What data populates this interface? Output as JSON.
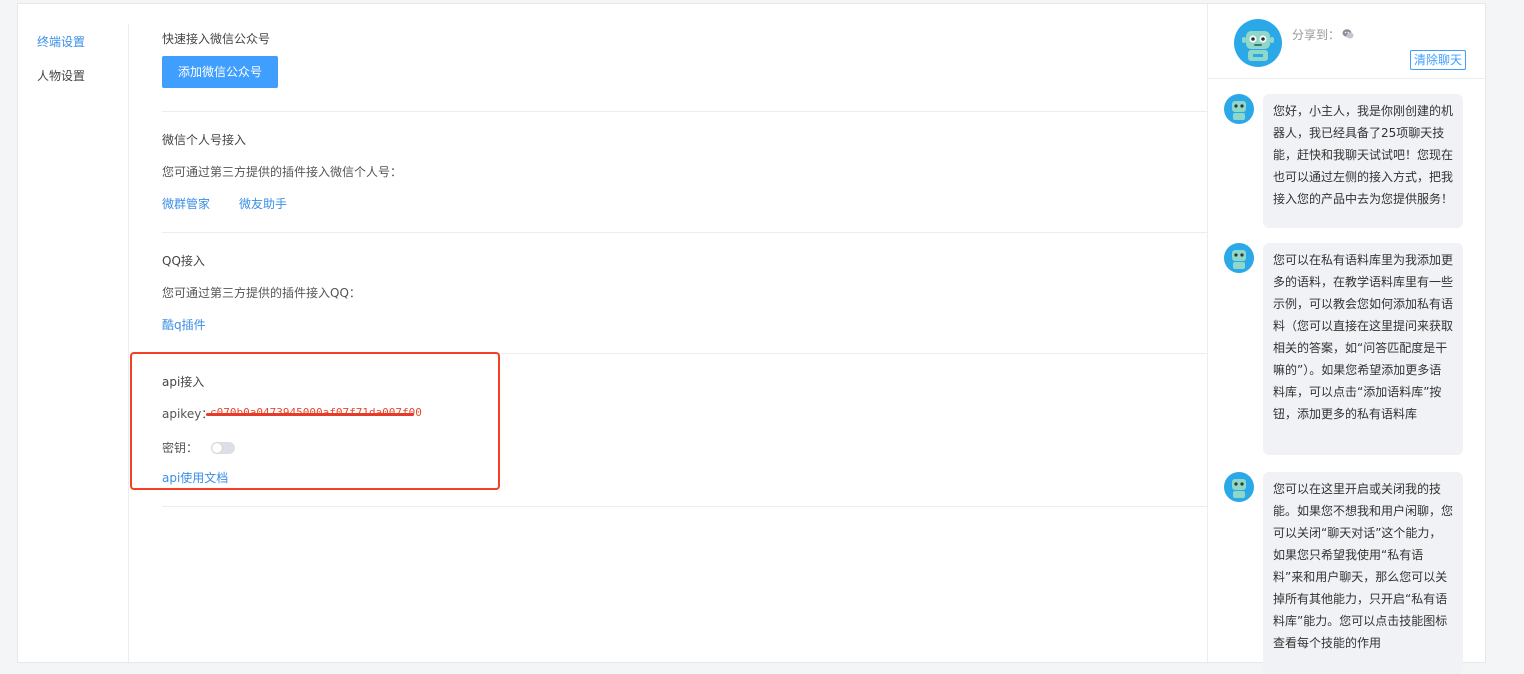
{
  "sidebar": {
    "items": [
      {
        "label": "终端设置",
        "active": true
      },
      {
        "label": "人物设置",
        "active": false
      }
    ]
  },
  "sections": {
    "wechat_public": {
      "title": "快速接入微信公众号",
      "button_label": "添加微信公众号"
    },
    "wechat_personal": {
      "title": "微信个人号接入",
      "description": "您可通过第三方提供的插件接入微信个人号：",
      "links": [
        "微群管家",
        "微友助手"
      ]
    },
    "qq": {
      "title": "QQ接入",
      "description": "您可通过第三方提供的插件接入QQ：",
      "links": [
        "酷q插件"
      ]
    },
    "api": {
      "title": "api接入",
      "apikey_label": "apikey：",
      "apikey_value": "c070b0a0473945000af07f71da007f00",
      "secret_label": "密钥：",
      "secret_enabled": false,
      "doc_link": "api使用文档"
    }
  },
  "chat": {
    "share_label": "分享到：",
    "clear_label": "清除聊天",
    "messages": [
      "您好，小主人，我是你刚创建的机器人，我已经具备了25项聊天技能，赶快和我聊天试试吧！您现在也可以通过左侧的接入方式，把我接入您的产品中去为您提供服务！",
      "您可以在私有语料库里为我添加更多的语料，在教学语料库里有一些示例，可以教会您如何添加私有语料（您可以直接在这里提问来获取相关的答案，如“问答匹配度是干嘛的”）。如果您希望添加更多语料库，可以点击“添加语料库”按钮，添加更多的私有语料库",
      "您可以在这里开启或关闭我的技能。如果您不想我和用户闲聊，您可以关闭“聊天对话”这个能力，如果您只希望我使用“私有语料”来和用户聊天，那么您可以关掉所有其他能力，只开启“私有语料库”能力。您可以点击技能图标查看每个技能的作用"
    ]
  },
  "colors": {
    "accent": "#409eff",
    "link": "#3a8ee6",
    "highlight": "#f33f23"
  }
}
